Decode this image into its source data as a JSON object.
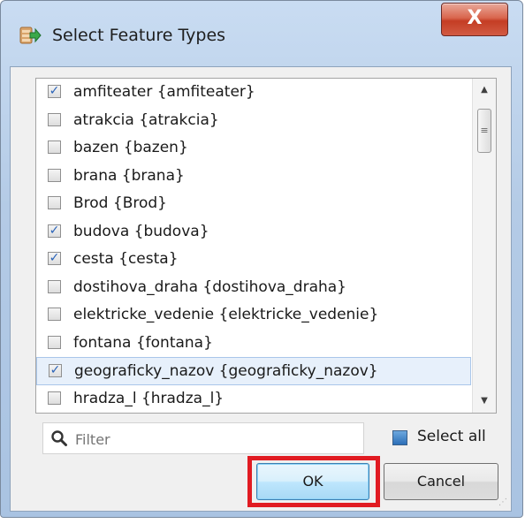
{
  "window": {
    "title": "Select Feature Types",
    "close_label": "X"
  },
  "list": {
    "items": [
      {
        "label": "amfiteater {amfiteater}",
        "checked": true,
        "selected": false
      },
      {
        "label": "atrakcia {atrakcia}",
        "checked": false,
        "selected": false
      },
      {
        "label": "bazen {bazen}",
        "checked": false,
        "selected": false
      },
      {
        "label": "brana {brana}",
        "checked": false,
        "selected": false
      },
      {
        "label": "Brod {Brod}",
        "checked": false,
        "selected": false
      },
      {
        "label": "budova {budova}",
        "checked": true,
        "selected": false
      },
      {
        "label": "cesta {cesta}",
        "checked": true,
        "selected": false
      },
      {
        "label": "dostihova_draha {dostihova_draha}",
        "checked": false,
        "selected": false
      },
      {
        "label": "elektricke_vedenie {elektricke_vedenie}",
        "checked": false,
        "selected": false
      },
      {
        "label": "fontana {fontana}",
        "checked": false,
        "selected": false
      },
      {
        "label": "geograficky_nazov {geograficky_nazov}",
        "checked": true,
        "selected": true
      },
      {
        "label": "hradza_l {hradza_l}",
        "checked": false,
        "selected": false
      }
    ]
  },
  "filter": {
    "placeholder": "Filter",
    "value": ""
  },
  "select_all": {
    "label": "Select all"
  },
  "buttons": {
    "ok": "OK",
    "cancel": "Cancel"
  },
  "colors": {
    "highlight": "#e11b22",
    "check": "#2a63b8",
    "select_all_box": "#2c6fb8"
  },
  "icons": {
    "app": "table-arrow-icon",
    "filter": "search-icon",
    "check": "✓"
  }
}
